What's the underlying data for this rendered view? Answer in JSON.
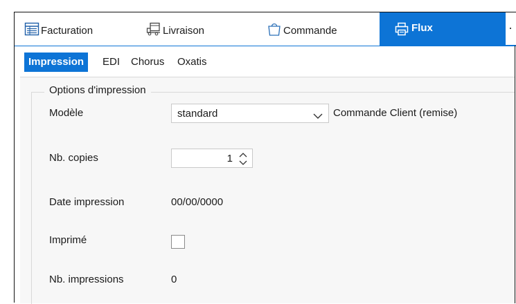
{
  "tabs": [
    {
      "label": "Facturation",
      "icon": "invoice-icon"
    },
    {
      "label": "Livraison",
      "icon": "delivery-icon"
    },
    {
      "label": "Commande",
      "icon": "shopping-bag-icon"
    },
    {
      "label": "Flux",
      "icon": "printer-icon",
      "active": true
    }
  ],
  "subtabs": [
    {
      "label": "Impression",
      "active": true
    },
    {
      "label": "EDI"
    },
    {
      "label": "Chorus"
    },
    {
      "label": "Oxatis"
    }
  ],
  "group": {
    "title": "Options d'impression"
  },
  "form": {
    "modele_label": "Modèle",
    "modele_value": "standard",
    "modele_desc": "Commande Client (remise)",
    "copies_label": "Nb. copies",
    "copies_value": "1",
    "date_label": "Date impression",
    "date_value": "00/00/0000",
    "imprime_label": "Imprimé",
    "imprime_checked": false,
    "nb_impressions_label": "Nb. impressions",
    "nb_impressions_value": "0"
  },
  "colors": {
    "accent": "#0d74d6",
    "panel": "#f7f7f7"
  }
}
